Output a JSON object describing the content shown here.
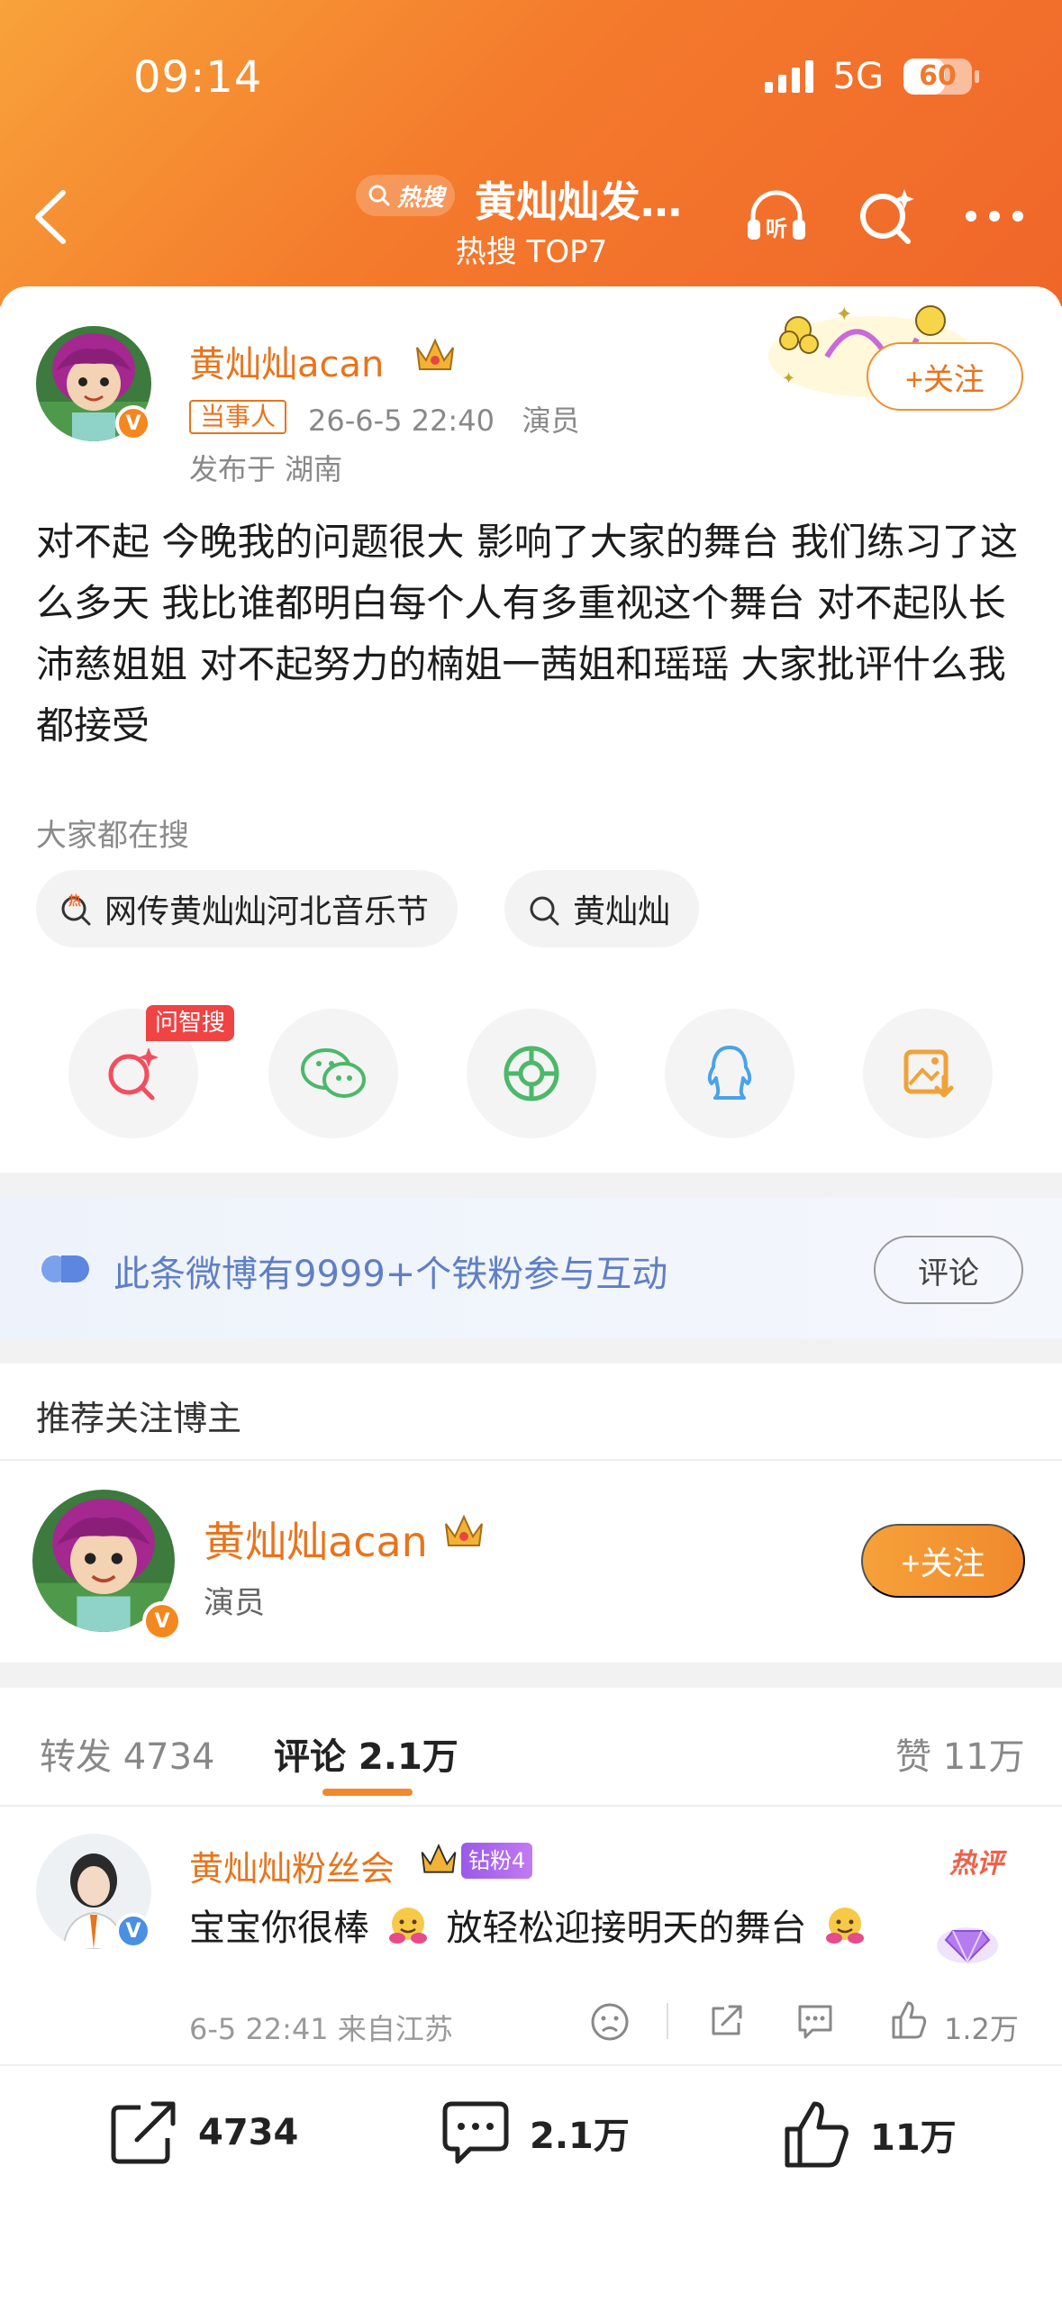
{
  "status_bar": {
    "time": "09:14",
    "network": "5G",
    "battery": "60",
    "battery_level": 0.6
  },
  "header": {
    "hot_chip": "热搜",
    "title": "黄灿灿发…",
    "subtitle": "热搜 TOP7"
  },
  "post": {
    "author_name": "黄灿灿acan",
    "party_tag": "当事人",
    "time": "26-6-5 22:40",
    "role": "演员",
    "location": "发布于 湖南",
    "follow_label": "+关注",
    "text": "对不起 今晚我的问题很大 影响了大家的舞台 我们练习了这么多天 我比谁都明白每个人有多重视这个舞台 对不起队长沛慈姐姐 对不起努力的楠姐一茜姐和瑶瑶 大家批评什么我都接受"
  },
  "search": {
    "label": "大家都在搜",
    "chips": [
      "网传黄灿灿河北音乐节",
      "黄灿灿"
    ],
    "chip_hot_mark": "热"
  },
  "share": {
    "ask_badge": "问智搜"
  },
  "fans_banner": {
    "text": "此条微博有9999+个铁粉参与互动",
    "button": "评论"
  },
  "recommend": {
    "title": "推荐关注博主",
    "name": "黄灿灿acan",
    "role": "演员",
    "follow_label": "+关注"
  },
  "tabs": {
    "repost": "转发 4734",
    "comment": "评论 2.1万",
    "like": "赞 11万"
  },
  "comment": {
    "name": "黄灿灿粉丝会",
    "level": "钻粉4",
    "hot": "热评",
    "text_a": "宝宝你很棒",
    "text_b": "放轻松迎接明天的舞台",
    "meta": "6-5 22:41 来自江苏",
    "likes": "1.2万"
  },
  "bottom_bar": {
    "repost": "4734",
    "comment": "2.1万",
    "like": "11万"
  },
  "colors": {
    "accent": "#f08a2c",
    "name": "#e8741c",
    "fans_blue": "#5f7fc4"
  }
}
